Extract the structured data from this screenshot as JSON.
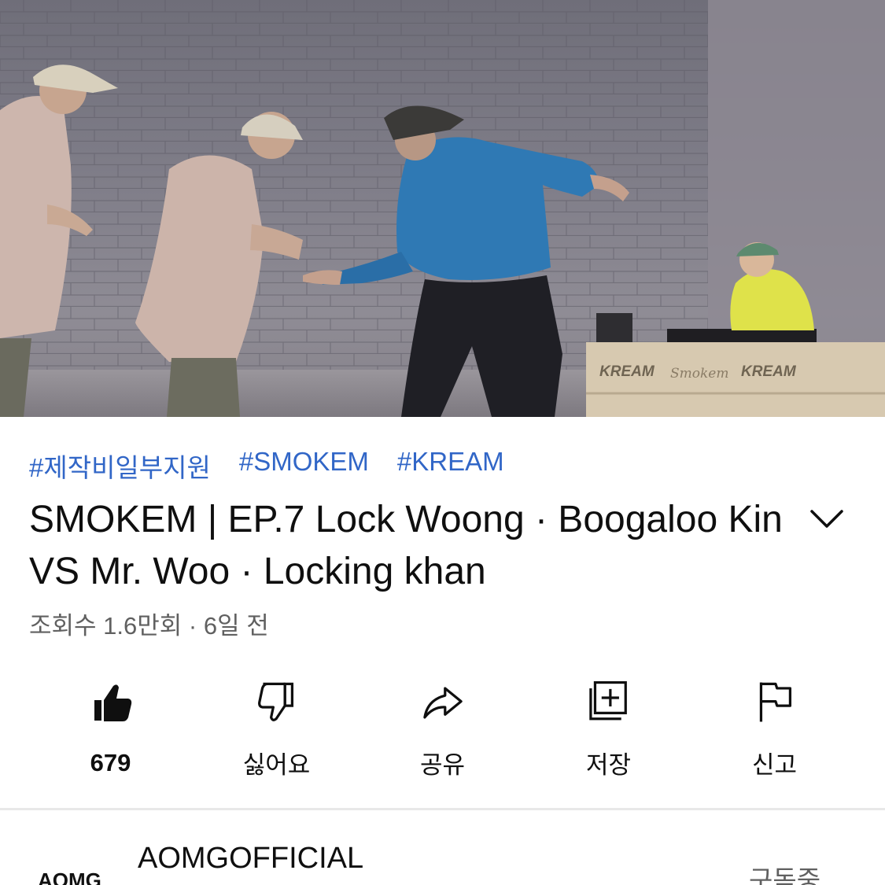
{
  "video": {
    "banner_text_1": "KREAM",
    "banner_text_2": "KREAM",
    "banner_script": "Smokem"
  },
  "hashtags": [
    "#제작비일부지원",
    "#SMOKEM",
    "#KREAM"
  ],
  "title": "SMOKEM | EP.7 Lock Woong · Boogaloo Kin VS Mr. Woo · Locking khan",
  "meta": "조회수 1.6만회 · 6일 전",
  "actions": [
    {
      "label": "679",
      "icon": "thumbs-up-filled"
    },
    {
      "label": "싫어요",
      "icon": "thumbs-down"
    },
    {
      "label": "공유",
      "icon": "share-arrow"
    },
    {
      "label": "저장",
      "icon": "save-playlist"
    },
    {
      "label": "신고",
      "icon": "flag"
    }
  ],
  "channel": {
    "name": "AOMGOFFICIAL",
    "avatar_text": "AOMG",
    "subscribe_status": "구독중"
  },
  "colors": {
    "hashtag": "#3166c7",
    "meta": "#606060",
    "text": "#0f0f0f"
  }
}
